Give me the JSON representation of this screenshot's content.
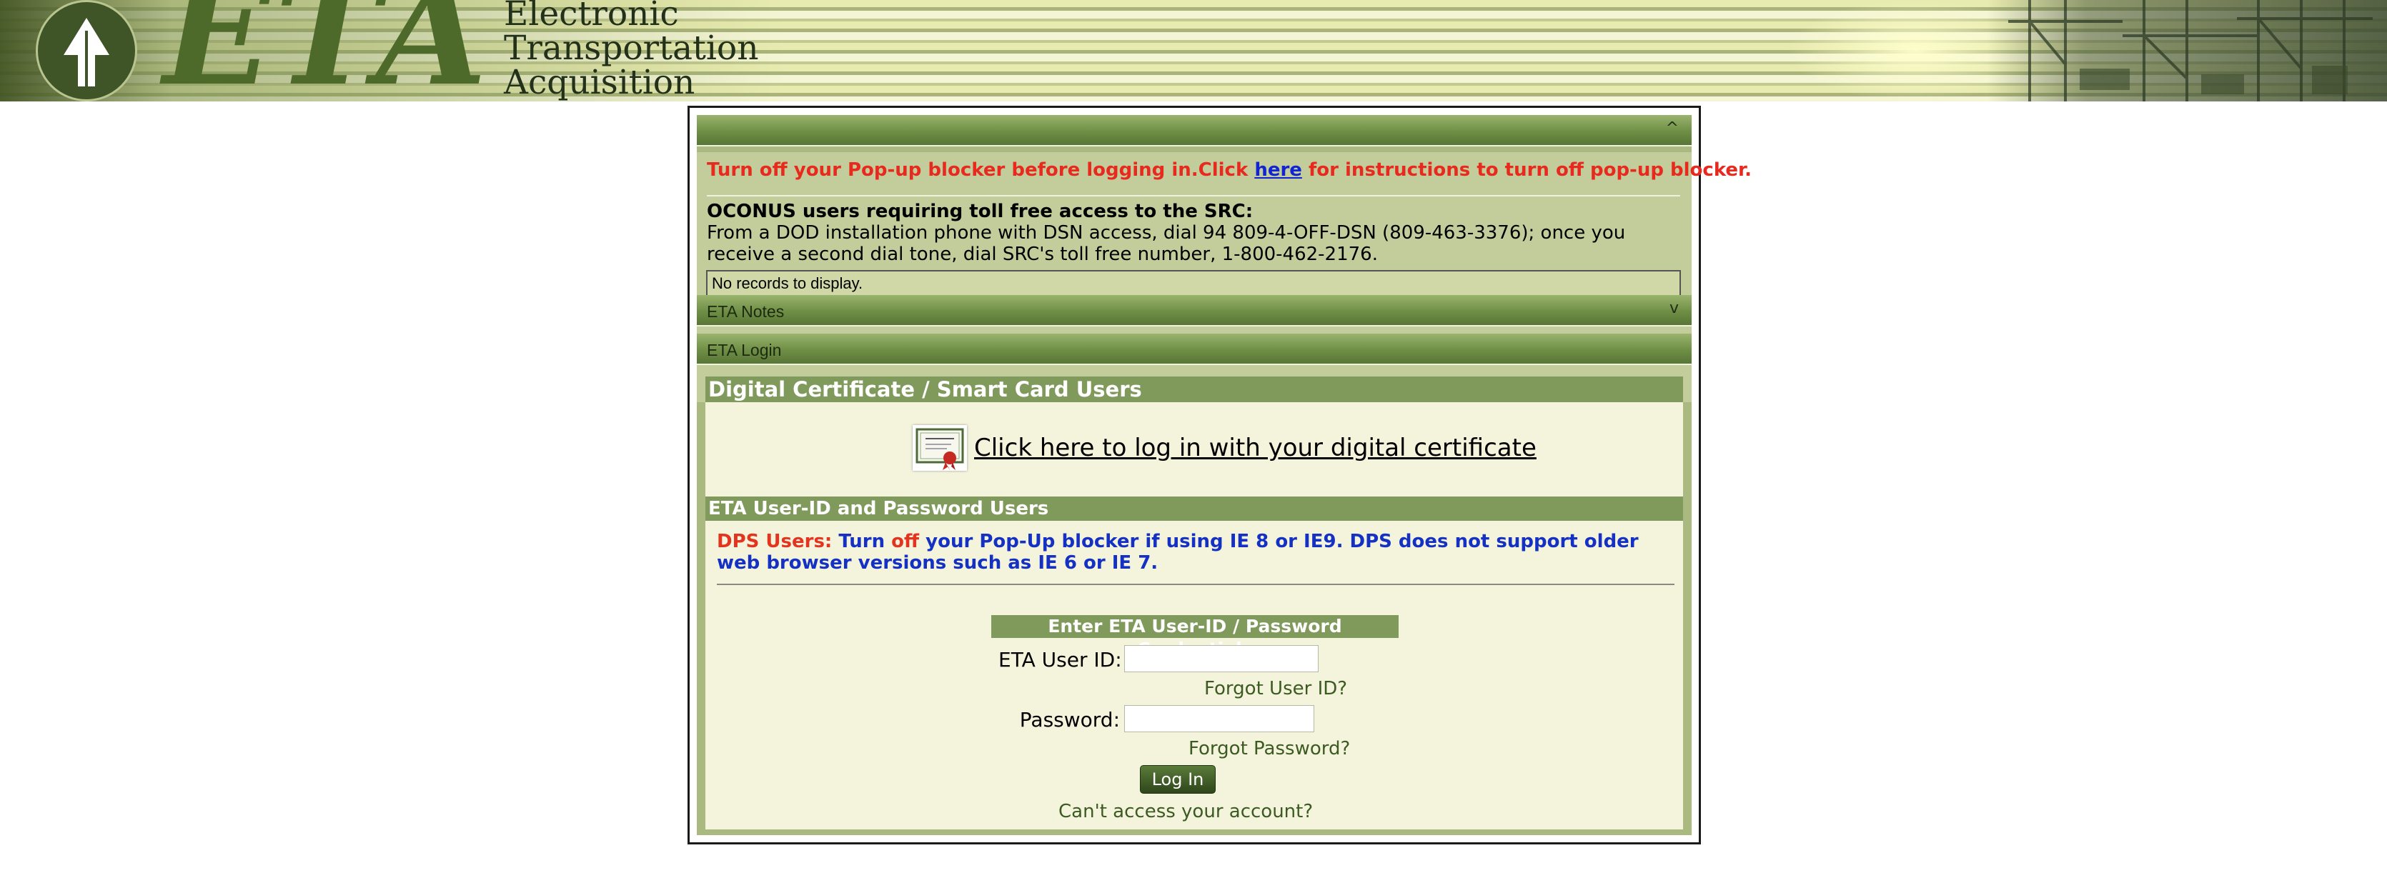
{
  "banner": {
    "logo_text": "ETA",
    "subtitle_lines": [
      "Electronic",
      "Transportation",
      "Acquisition"
    ]
  },
  "notice_bar": {
    "collapse_glyph": "^",
    "popup_prefix": "Turn off your Pop-up blocker before logging in.Click ",
    "popup_link": "here",
    "popup_suffix": " for instructions to turn off pop-up blocker.",
    "oconus_title": "OCONUS users requiring toll free access to the SRC:",
    "oconus_text": "From a DOD installation phone with DSN access, dial 94 809-4-OFF-DSN (809-463-3376); once you receive a second dial tone, dial SRC's toll free number, 1-800-462-2176.",
    "no_records": "No records to display."
  },
  "notes_bar": {
    "label": "ETA Notes",
    "expand_glyph": "v"
  },
  "login_bar": {
    "label": "ETA Login"
  },
  "cert_section": {
    "heading": "Digital Certificate / Smart Card Users",
    "link": "Click here to log in with your digital certificate"
  },
  "password_section": {
    "heading": "ETA User-ID and Password Users",
    "dps_label": "DPS Users:",
    "dps_text_1": " Turn ",
    "dps_off": "off",
    "dps_text_2": " your Pop-Up blocker if using IE 8 or IE9. DPS does not support older web browser versions such as IE 6 or IE 7.",
    "credentials_heading": "Enter ETA User-ID / Password Credentials",
    "user_id_label": "ETA User ID:",
    "user_id_value": "",
    "forgot_user_id": "Forgot User ID?",
    "password_label": "Password:",
    "password_value": "",
    "forgot_password": "Forgot Password?",
    "login_button": "Log In",
    "cant_access": "Can't access your account?"
  },
  "colors": {
    "accent_green": "#7f9a5b",
    "warning_red": "#e8291d",
    "link_blue": "#1024d4"
  }
}
